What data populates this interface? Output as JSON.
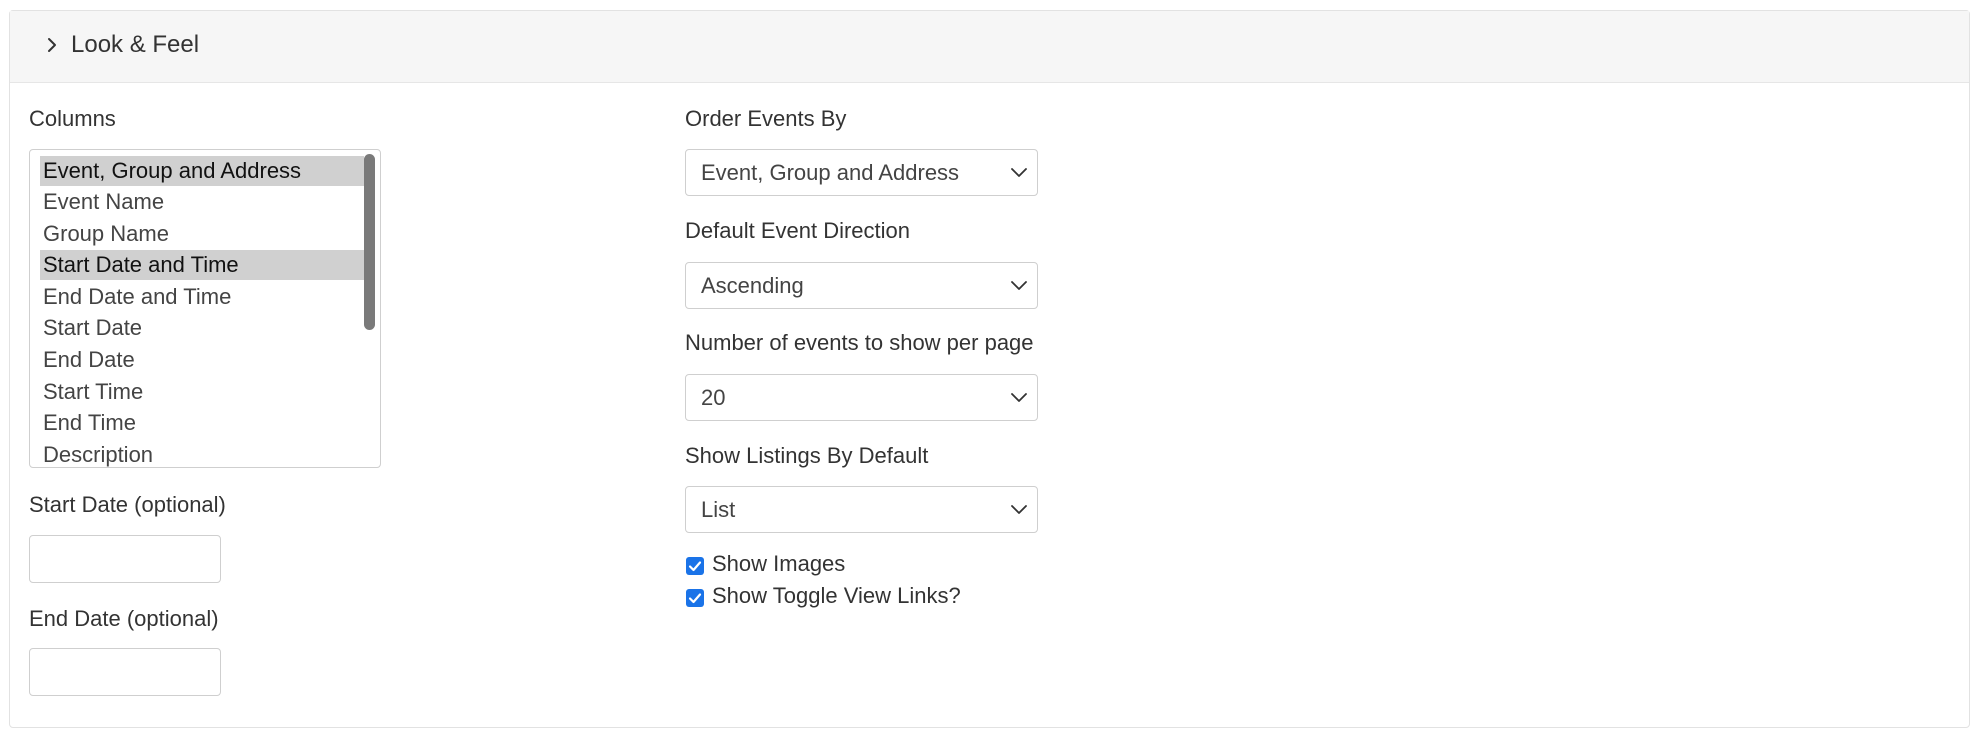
{
  "panel": {
    "title": "Look & Feel"
  },
  "columns": {
    "label": "Columns",
    "options": [
      {
        "label": "Event, Group and Address",
        "selected": true
      },
      {
        "label": "Event Name",
        "selected": false
      },
      {
        "label": "Group Name",
        "selected": false
      },
      {
        "label": "Start Date and Time",
        "selected": true
      },
      {
        "label": "End Date and Time",
        "selected": false
      },
      {
        "label": "Start Date",
        "selected": false
      },
      {
        "label": "End Date",
        "selected": false
      },
      {
        "label": "Start Time",
        "selected": false
      },
      {
        "label": "End Time",
        "selected": false
      },
      {
        "label": "Description",
        "selected": false
      }
    ]
  },
  "start_date": {
    "label": "Start Date (optional)",
    "value": ""
  },
  "end_date": {
    "label": "End Date (optional)",
    "value": ""
  },
  "order_events": {
    "label": "Order Events By",
    "value": "Event, Group and Address"
  },
  "default_direction": {
    "label": "Default Event Direction",
    "value": "Ascending"
  },
  "events_per_page": {
    "label": "Number of events to show per page",
    "value": "20"
  },
  "show_listings": {
    "label": "Show Listings By Default",
    "value": "List"
  },
  "checkboxes": {
    "show_images": {
      "label": "Show Images",
      "checked": true
    },
    "show_toggle": {
      "label": "Show Toggle View Links?",
      "checked": true
    }
  },
  "colors": {
    "accent": "#1a73e8",
    "header_bg": "#f6f6f6",
    "selected_option": "#d0d0d0"
  },
  "icons": {
    "header_toggle": "chevron-right-icon",
    "select_caret": "chevron-down-icon"
  }
}
